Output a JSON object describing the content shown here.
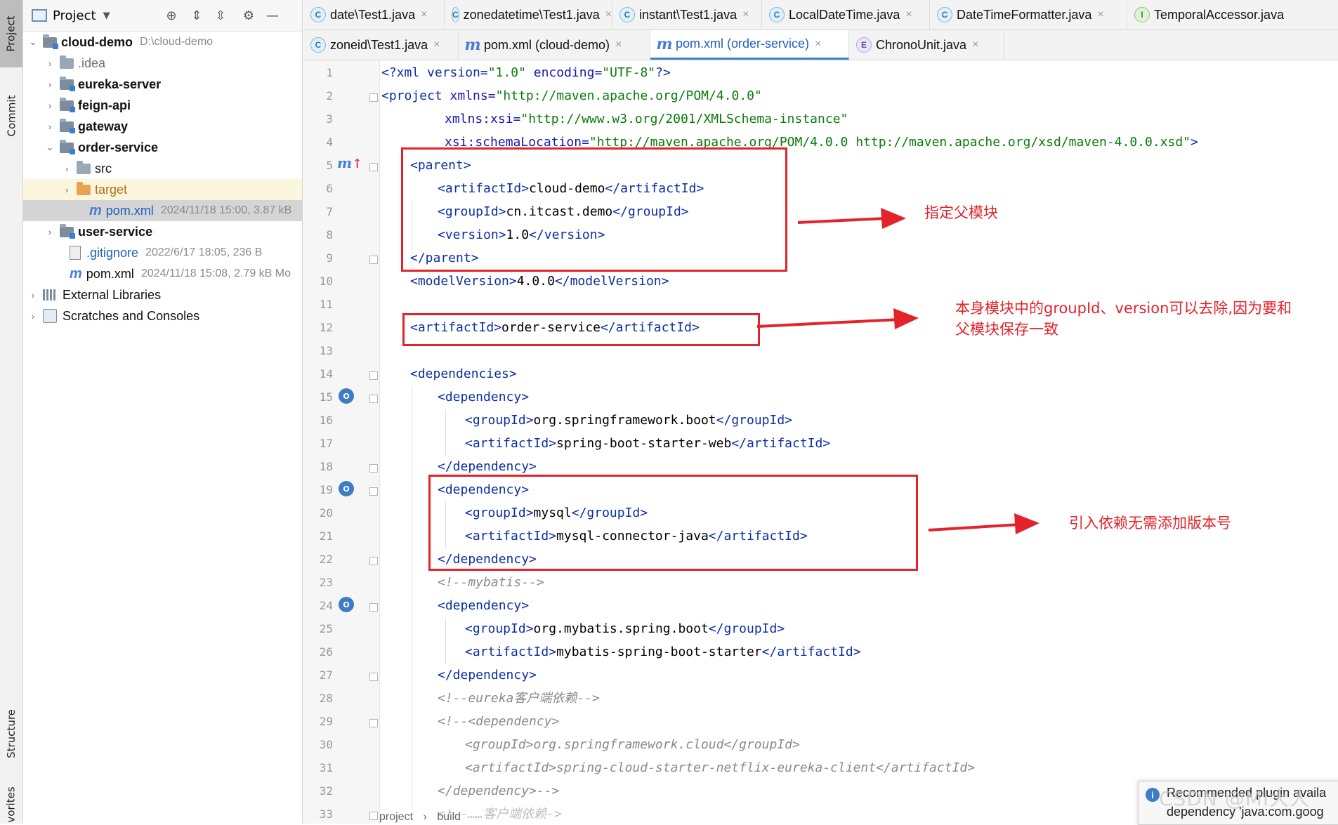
{
  "toolstrip": {
    "project": "Project",
    "commit": "Commit",
    "structure": "Structure",
    "favorites": "vorites"
  },
  "project_panel": {
    "title": "Project",
    "tree": [
      {
        "name": "cloud-demo",
        "meta": "D:\\cloud-demo"
      },
      {
        "name": ".idea",
        "meta": ""
      },
      {
        "name": "eureka-server",
        "meta": ""
      },
      {
        "name": "feign-api",
        "meta": ""
      },
      {
        "name": "gateway",
        "meta": ""
      },
      {
        "name": "order-service",
        "meta": ""
      },
      {
        "name": "src",
        "meta": ""
      },
      {
        "name": "target",
        "meta": ""
      },
      {
        "name": "pom.xml",
        "meta": "2024/11/18 15:00, 3.87 kB"
      },
      {
        "name": "user-service",
        "meta": ""
      },
      {
        "name": ".gitignore",
        "meta": "2022/6/17 18:05, 236 B"
      },
      {
        "name": "pom.xml",
        "meta": "2024/11/18 15:08, 2.79 kB Mo"
      },
      {
        "name": "External Libraries",
        "meta": ""
      },
      {
        "name": "Scratches and Consoles",
        "meta": ""
      }
    ]
  },
  "tabs": {
    "row1": [
      {
        "label": "date\\Test1.java",
        "icon": "C"
      },
      {
        "label": "zonedatetime\\Test1.java",
        "icon": "C"
      },
      {
        "label": "instant\\Test1.java",
        "icon": "C"
      },
      {
        "label": "LocalDateTime.java",
        "icon": "C"
      },
      {
        "label": "DateTimeFormatter.java",
        "icon": "C"
      },
      {
        "label": "TemporalAccessor.java",
        "icon": "I"
      }
    ],
    "row2": [
      {
        "label": "zoneid\\Test1.java",
        "icon": "C"
      },
      {
        "label": "pom.xml (cloud-demo)",
        "icon": "m"
      },
      {
        "label": "pom.xml (order-service)",
        "icon": "m"
      },
      {
        "label": "ChronoUnit.java",
        "icon": "E"
      }
    ],
    "close": "×"
  },
  "editor": {
    "line_numbers": [
      "1",
      "2",
      "3",
      "4",
      "5",
      "6",
      "7",
      "8",
      "9",
      "10",
      "11",
      "12",
      "13",
      "14",
      "15",
      "16",
      "17",
      "18",
      "19",
      "20",
      "21",
      "22",
      "23",
      "24",
      "25",
      "26",
      "27",
      "28",
      "29",
      "30",
      "31",
      "32",
      "33"
    ],
    "lines": {
      "l1": {
        "p1": "<?xml version=",
        "p2": "\"1.0\"",
        "p3": " encoding=",
        "p4": "\"UTF-8\"",
        "p5": "?>"
      },
      "l2": {
        "p1": "<project",
        "p2": " xmlns=",
        "p3": "\"http://maven.apache.org/POM/4.0.0\""
      },
      "l3": {
        "p1": "xmlns:xsi=",
        "p2": "\"http://www.w3.org/2001/XMLSchema-instance\""
      },
      "l4": {
        "p1": "xsi:schemaLocation=",
        "p2": "\"http://maven.apache.org/POM/4.0.0 http://maven.apache.org/xsd/maven-4.0.0.xsd\"",
        "p3": ">"
      },
      "l5": "<parent>",
      "l6": {
        "open": "<artifactId>",
        "val": "cloud-demo",
        "close": "</artifactId>"
      },
      "l7": {
        "open": "<groupId>",
        "val": "cn.itcast.demo",
        "close": "</groupId>"
      },
      "l8": {
        "open": "<version>",
        "val": "1.0",
        "close": "</version>"
      },
      "l9": "</parent>",
      "l10": {
        "open": "<modelVersion>",
        "val": "4.0.0",
        "close": "</modelVersion>"
      },
      "l12": {
        "open": "<artifactId>",
        "val": "order-service",
        "close": "</artifactId>"
      },
      "l14": "<dependencies>",
      "l15": "<dependency>",
      "l16": {
        "open": "<groupId>",
        "val": "org.springframework.boot",
        "close": "</groupId>"
      },
      "l17": {
        "open": "<artifactId>",
        "val": "spring-boot-starter-web",
        "close": "</artifactId>"
      },
      "l18": "</dependency>",
      "l19": "<dependency>",
      "l20": {
        "open": "<groupId>",
        "val": "mysql",
        "close": "</groupId>"
      },
      "l21": {
        "open": "<artifactId>",
        "val": "mysql-connector-java",
        "close": "</artifactId>"
      },
      "l22": "</dependency>",
      "l23": "<!--mybatis-->",
      "l24": "<dependency>",
      "l25": {
        "open": "<groupId>",
        "val": "org.mybatis.spring.boot",
        "close": "</groupId>"
      },
      "l26": {
        "open": "<artifactId>",
        "val": "mybatis-spring-boot-starter",
        "close": "</artifactId>"
      },
      "l27": "</dependency>",
      "l28": "<!--eureka客户端依赖-->",
      "l29": "<!--<dependency>",
      "l30": "<groupId>org.springframework.cloud</groupId>",
      "l31": "<artifactId>spring-cloud-starter-netflix-eureka-client</artifactId>",
      "l32": "</dependency>-->",
      "l33": "<!--……客户端依赖->"
    }
  },
  "annotations": {
    "a1": "指定父模块",
    "a2_line1": "本身模块中的groupId、version可以去除,因为要和",
    "a2_line2": "父模块保存一致",
    "a3": "引入依赖无需添加版本号",
    "color": "#e3222a"
  },
  "breadcrumb": {
    "b1": "project",
    "sep": "›",
    "b2": "build"
  },
  "popup": {
    "line1": "Recommended plugin availa",
    "line2": "dependency 'java:com.goog"
  },
  "watermark": "CSDN @MI大人"
}
